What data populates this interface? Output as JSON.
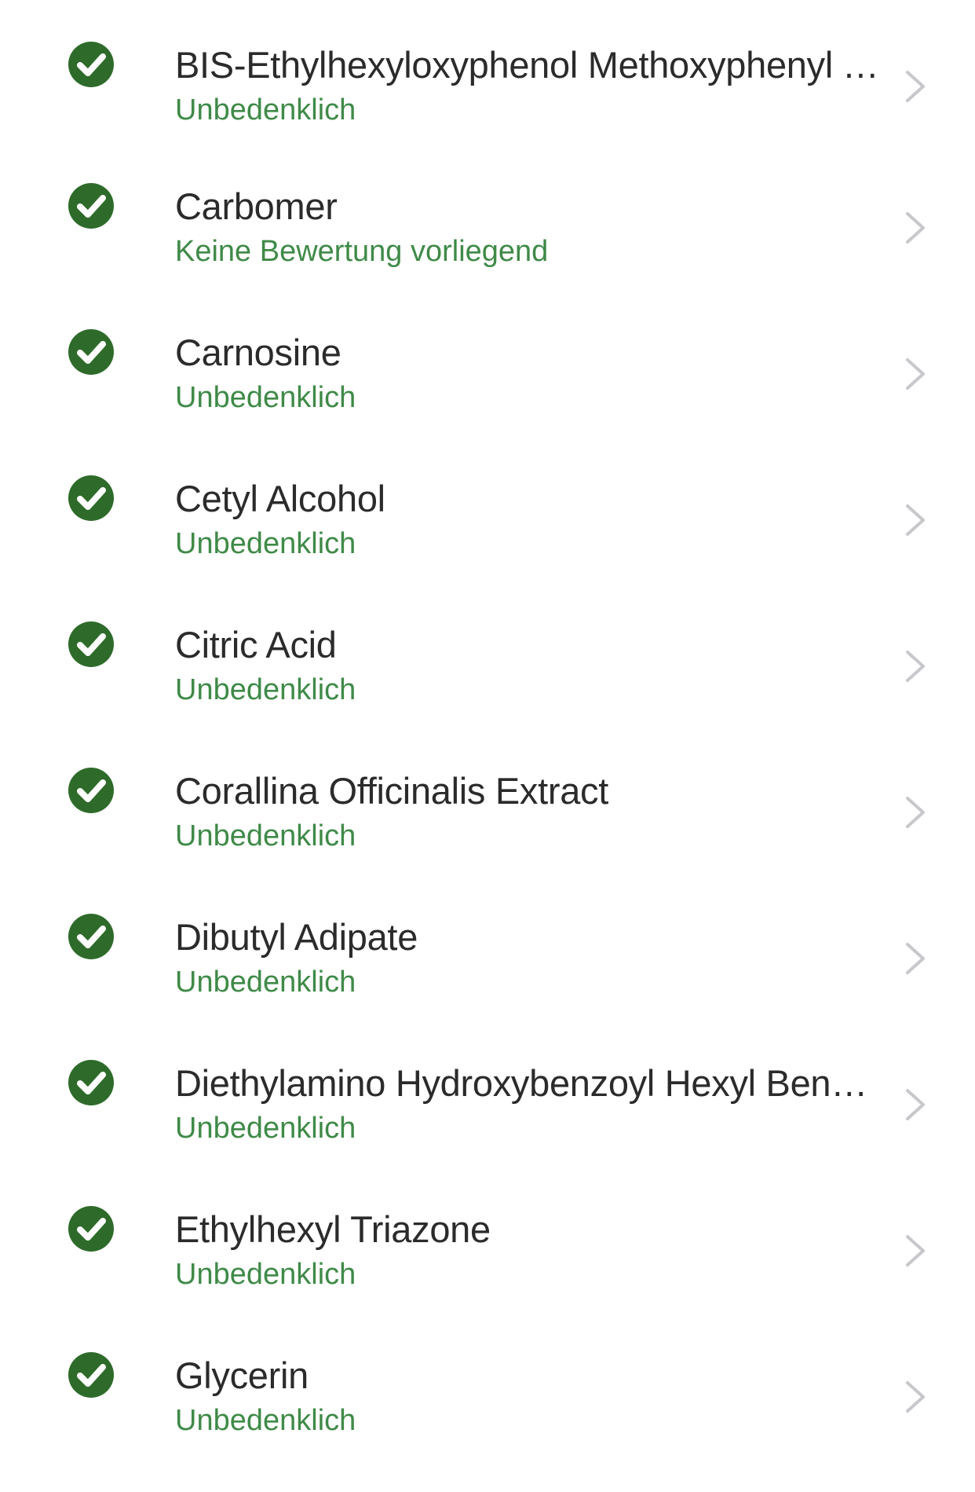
{
  "colors": {
    "check": "#2e6b2a",
    "status_text": "#3f8a48",
    "name_text": "#2b2b2b",
    "chevron": "#c7c7cc"
  },
  "icons": {
    "status": "check-circle-icon",
    "disclosure": "chevron-right-icon"
  },
  "ingredients": [
    {
      "name": "BIS-Ethylhexyloxyphenol Methoxyphenyl Tria...",
      "status": "Unbedenklich"
    },
    {
      "name": "Carbomer",
      "status": "Keine Bewertung vorliegend"
    },
    {
      "name": "Carnosine",
      "status": "Unbedenklich"
    },
    {
      "name": "Cetyl Alcohol",
      "status": "Unbedenklich"
    },
    {
      "name": "Citric Acid",
      "status": "Unbedenklich"
    },
    {
      "name": "Corallina Officinalis Extract",
      "status": "Unbedenklich"
    },
    {
      "name": "Dibutyl Adipate",
      "status": "Unbedenklich"
    },
    {
      "name": "Diethylamino Hydroxybenzoyl Hexyl Benzoate",
      "status": "Unbedenklich"
    },
    {
      "name": "Ethylhexyl Triazone",
      "status": "Unbedenklich"
    },
    {
      "name": "Glycerin",
      "status": "Unbedenklich"
    }
  ]
}
